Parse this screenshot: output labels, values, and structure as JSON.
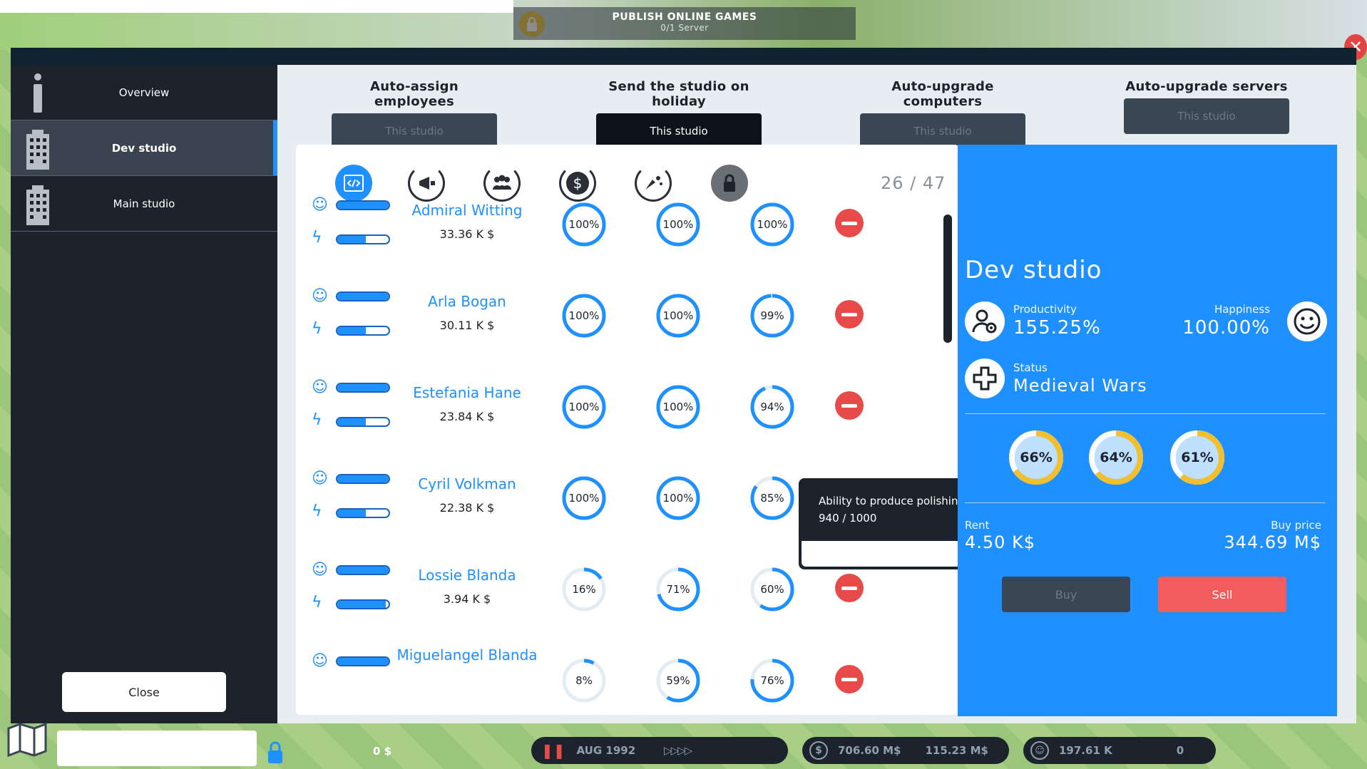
{
  "top": {
    "publish_title": "PUBLISH ONLINE GAMES",
    "publish_sub": "0/1 Server"
  },
  "sidebar": {
    "items": [
      {
        "label": "Overview",
        "icon": "info-icon"
      },
      {
        "label": "Dev studio",
        "icon": "building-icon",
        "active": true
      },
      {
        "label": "Main studio",
        "icon": "building-icon"
      }
    ],
    "close_label": "Close"
  },
  "actions": [
    {
      "label": "Auto-assign employees",
      "button": "This studio",
      "active": false
    },
    {
      "label": "Send the studio on holiday",
      "button": "This studio",
      "active": true
    },
    {
      "label": "Auto-upgrade computers",
      "button": "This studio",
      "active": false
    },
    {
      "label": "Auto-upgrade servers",
      "button": "This studio",
      "active": false
    }
  ],
  "list": {
    "count": "26 / 47",
    "columns": [
      "code-icon",
      "marketing-icon",
      "team-icon",
      "dollar-icon",
      "polish-icon",
      "lock-icon"
    ],
    "employees": [
      {
        "name": "Admiral Witting",
        "salary": "33.36 K $",
        "happiness": 1.0,
        "energy": 0.55,
        "stats": [
          {
            "label": "100%",
            "value": 1.0
          },
          {
            "label": "100%",
            "value": 1.0
          },
          {
            "label": "100%",
            "value": 1.0
          }
        ]
      },
      {
        "name": "Arla Bogan",
        "salary": "30.11 K $",
        "happiness": 1.0,
        "energy": 0.55,
        "stats": [
          {
            "label": "100%",
            "value": 1.0
          },
          {
            "label": "100%",
            "value": 1.0
          },
          {
            "label": "99%",
            "value": 0.99
          }
        ]
      },
      {
        "name": "Estefania Hane",
        "salary": "23.84 K $",
        "happiness": 1.0,
        "energy": 0.55,
        "stats": [
          {
            "label": "100%",
            "value": 1.0
          },
          {
            "label": "100%",
            "value": 1.0
          },
          {
            "label": "94%",
            "value": 0.94
          }
        ]
      },
      {
        "name": "Cyril Volkman",
        "salary": "22.38 K $",
        "happiness": 1.0,
        "energy": 0.55,
        "stats": [
          {
            "label": "100%",
            "value": 1.0
          },
          {
            "label": "100%",
            "value": 1.0
          },
          {
            "label": "85%",
            "value": 0.85
          }
        ]
      },
      {
        "name": "Lossie Blanda",
        "salary": "3.94 K $",
        "happiness": 1.0,
        "energy": 0.95,
        "stats": [
          {
            "label": "16%",
            "value": 0.16
          },
          {
            "label": "71%",
            "value": 0.71
          },
          {
            "label": "60%",
            "value": 0.6
          }
        ]
      },
      {
        "name": "Miguelangel Blanda",
        "salary": "",
        "happiness": 1.0,
        "energy": 0.55,
        "stats": [
          {
            "label": "8%",
            "value": 0.08
          },
          {
            "label": "59%",
            "value": 0.59
          },
          {
            "label": "76%",
            "value": 0.76
          }
        ]
      }
    ]
  },
  "tooltip": {
    "line1": "Ability to produce polishing points",
    "line2": "940 / 1000"
  },
  "panel": {
    "title": "Dev studio",
    "productivity_label": "Productivity",
    "productivity_value": "155.25%",
    "happiness_label": "Happiness",
    "happiness_value": "100.00%",
    "status_label": "Status",
    "status_value": "Medieval Wars",
    "gauges": [
      {
        "label": "66%",
        "value": 0.66
      },
      {
        "label": "64%",
        "value": 0.64
      },
      {
        "label": "61%",
        "value": 0.61
      }
    ],
    "rent_label": "Rent",
    "rent_value": "4.50 K$",
    "buy_price_label": "Buy price",
    "buy_price_value": "344.69 M$",
    "buy_label": "Buy",
    "sell_label": "Sell"
  },
  "hud": {
    "date": "AUG  1992",
    "money": "706.60 M$",
    "income": "115.23 M$",
    "fans": "197.61 K",
    "zero": "0",
    "zero_left": "0 $"
  },
  "colors": {
    "accent": "#1e90ff",
    "danger": "#e84a4a",
    "dark": "#1c232c",
    "gauge": "#f2c02e"
  }
}
